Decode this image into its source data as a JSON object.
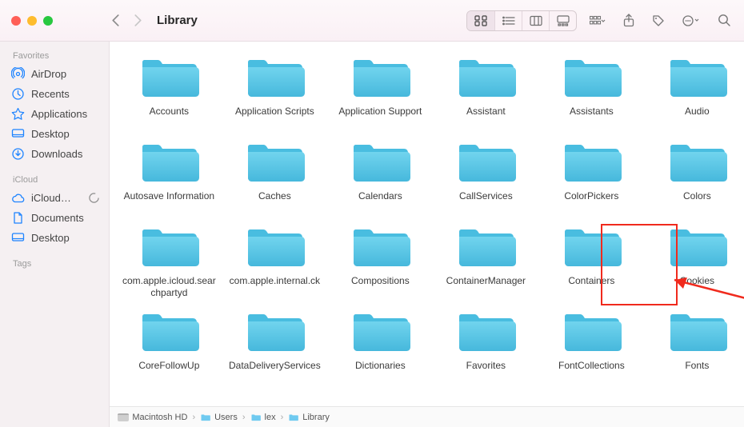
{
  "window": {
    "title": "Library"
  },
  "sidebar": {
    "sections": [
      {
        "heading": "Favorites",
        "items": [
          {
            "label": "AirDrop",
            "icon": "airdrop-icon"
          },
          {
            "label": "Recents",
            "icon": "clock-icon"
          },
          {
            "label": "Applications",
            "icon": "app-icon"
          },
          {
            "label": "Desktop",
            "icon": "desktop-icon"
          },
          {
            "label": "Downloads",
            "icon": "download-icon"
          }
        ]
      },
      {
        "heading": "iCloud",
        "items": [
          {
            "label": "iCloud…",
            "icon": "cloud-icon",
            "trailing_icon": "progress-icon"
          },
          {
            "label": "Documents",
            "icon": "doc-icon"
          },
          {
            "label": "Desktop",
            "icon": "desktop-icon"
          }
        ]
      },
      {
        "heading": "Tags",
        "items": []
      }
    ]
  },
  "view_modes": [
    {
      "id": "icon",
      "active": true
    },
    {
      "id": "list",
      "active": false
    },
    {
      "id": "column",
      "active": false
    },
    {
      "id": "gallery",
      "active": false
    }
  ],
  "folders": [
    {
      "name": "Accounts"
    },
    {
      "name": "Application Scripts"
    },
    {
      "name": "Application Support"
    },
    {
      "name": "Assistant"
    },
    {
      "name": "Assistants"
    },
    {
      "name": "Audio"
    },
    {
      "name": "Autosave Information"
    },
    {
      "name": "Caches"
    },
    {
      "name": "Calendars"
    },
    {
      "name": "CallServices"
    },
    {
      "name": "ColorPickers"
    },
    {
      "name": "Colors"
    },
    {
      "name": "com.apple.icloud.searchpartyd"
    },
    {
      "name": "com.apple.internal.ck"
    },
    {
      "name": "Compositions"
    },
    {
      "name": "ContainerManager"
    },
    {
      "name": "Containers",
      "annotated": true
    },
    {
      "name": "Cookies"
    },
    {
      "name": "CoreFollowUp"
    },
    {
      "name": "DataDeliveryServices"
    },
    {
      "name": "Dictionaries"
    },
    {
      "name": "Favorites"
    },
    {
      "name": "FontCollections"
    },
    {
      "name": "Fonts"
    }
  ],
  "pathbar": [
    {
      "label": "Macintosh HD",
      "icon": "disk"
    },
    {
      "label": "Users",
      "icon": "folder"
    },
    {
      "label": "lex",
      "icon": "folder"
    },
    {
      "label": "Library",
      "icon": "folder"
    }
  ],
  "colors": {
    "folder_fill": "#5ac8e8",
    "folder_fill_dark": "#46b8dc",
    "accent": "#1e84ff",
    "annotation": "#f02a1d"
  }
}
